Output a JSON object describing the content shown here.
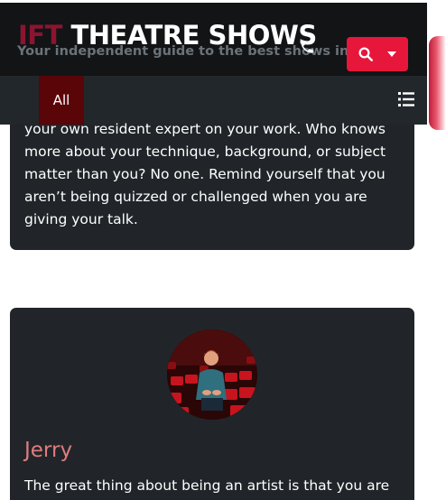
{
  "header": {
    "logo_prefix": "IFT",
    "logo_rest": " THEATRE SHOWS",
    "tagline": "Your independent guide to the best shows in IFT"
  },
  "nav": {
    "active_item": "All"
  },
  "card1": {
    "body": "your own resident expert on your work. Who knows more about your technique, background, or subject matter than you? No one. Remind yourself that you aren’t being quizzed or challenged when you are giving your talk."
  },
  "card2": {
    "author": "Jerry",
    "body": "The great thing about being an artist is that you are"
  },
  "icons": {
    "phone": "phone-icon",
    "search": "search-icon",
    "dropdown": "caret-down-icon",
    "menu": "list-icon"
  },
  "colors": {
    "header_bg": "#121416",
    "navbar_bg": "#22272b",
    "active_nav_bg": "#5a0508",
    "search_button": "#e6173b",
    "card_bg": "#212529",
    "author_name": "#e07c80",
    "logo_prefix": "#8b1530"
  }
}
